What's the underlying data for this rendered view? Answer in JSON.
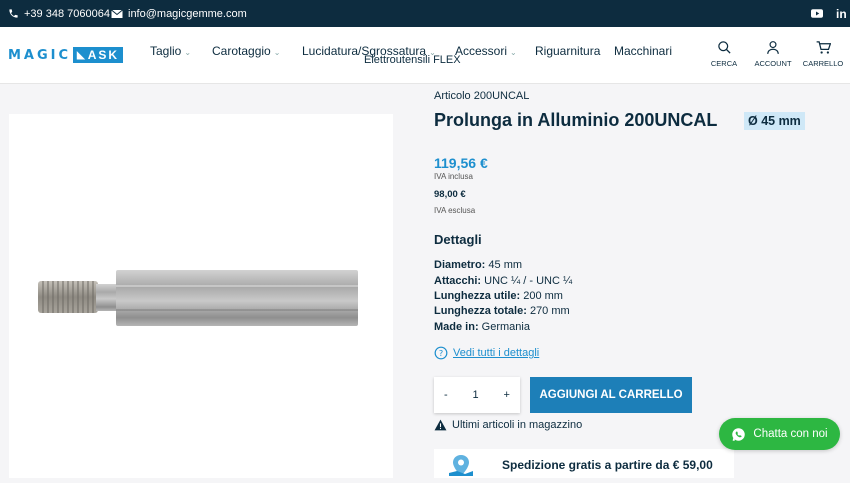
{
  "topbar": {
    "phone": "+39 348 7060064",
    "email": "info@magicgemme.com",
    "social": [
      "youtube-icon",
      "linkedin-icon"
    ]
  },
  "logo": {
    "left": "MAGIC",
    "right": "ASK"
  },
  "nav": {
    "items": [
      {
        "label": "Taglio",
        "dropdown": true
      },
      {
        "label": "Carotaggio",
        "dropdown": true
      },
      {
        "label": "Lucidatura/Sgrossatura",
        "dropdown": true
      },
      {
        "label": "Accessori",
        "dropdown": true
      },
      {
        "label": "Riguarnitura",
        "dropdown": false
      },
      {
        "label": "Macchinari",
        "dropdown": false
      }
    ],
    "second_row": "Elettroutensili FLEX"
  },
  "header_icons": {
    "search": "CERCA",
    "account": "ACCOUNT",
    "cart": "CARRELLO"
  },
  "product": {
    "article": "Articolo 200UNCAL",
    "title": "Prolunga in Alluminio 200UNCAL",
    "badge": "Ø 45 mm",
    "price_incl": "119,56 €",
    "price_incl_note": "IVA inclusa",
    "price_excl": "98,00 €",
    "price_excl_note": "IVA esclusa",
    "details_title": "Dettagli",
    "specs": [
      {
        "label": "Diametro:",
        "value": " 45 mm"
      },
      {
        "label": "Attacchi:",
        "value": " UNC ¼ / - UNC ¼"
      },
      {
        "label": "Lunghezza utile:",
        "value": " 200 mm"
      },
      {
        "label": "Lunghezza totale:",
        "value": " 270 mm"
      },
      {
        "label": "Made in:",
        "value": " Germania"
      }
    ],
    "details_link": "Vedi tutti i dettagli",
    "quantity": {
      "minus": "-",
      "value": "1",
      "plus": "+"
    },
    "add_to_cart": "AGGIUNGI AL CARRELLO",
    "stock_note": "Ultimi articoli in magazzino",
    "shipping": "Spedizione gratis a partire da € 59,00"
  },
  "chat": {
    "label": "Chatta con noi"
  },
  "colors": {
    "navy": "#0d2c3f",
    "accent": "#1d8fce",
    "button": "#1d7fb8",
    "whatsapp": "#2db742",
    "badge_bg": "#cfe8f7"
  }
}
